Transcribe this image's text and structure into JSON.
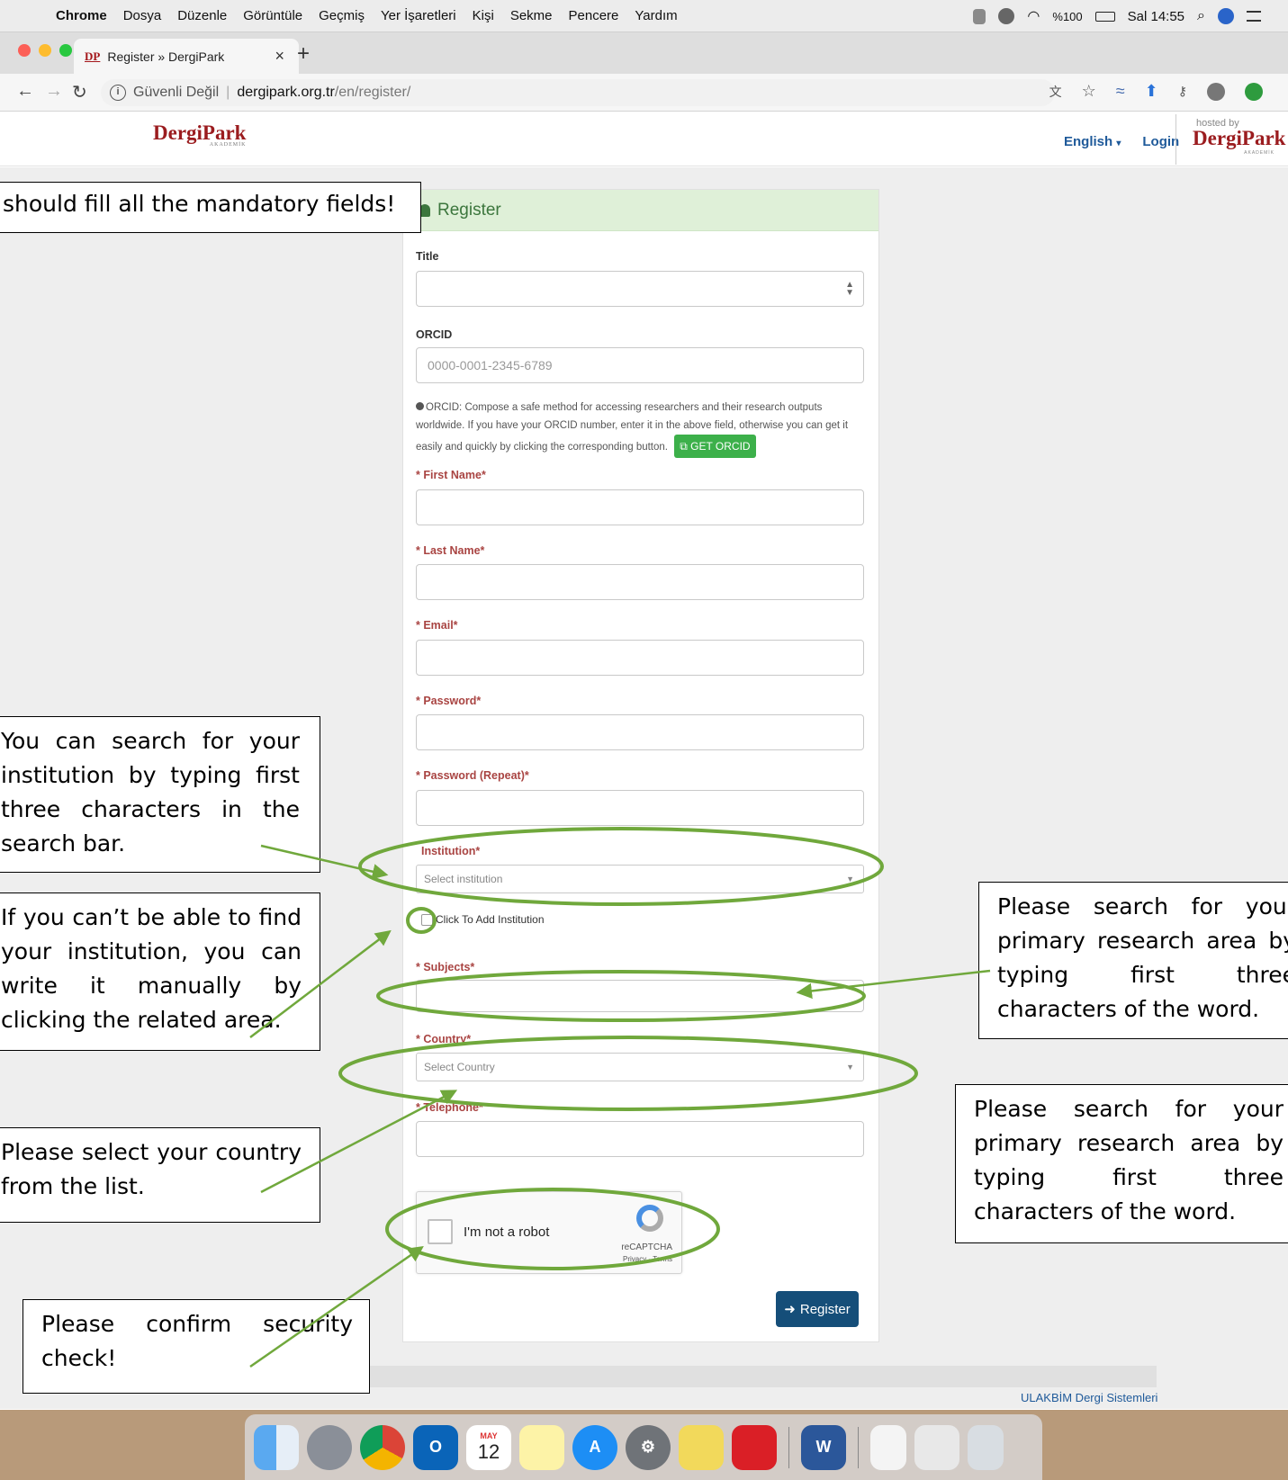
{
  "menubar": {
    "app": "Chrome",
    "items": [
      "Dosya",
      "Düzenle",
      "Görüntüle",
      "Geçmiş",
      "Yer İşaretleri",
      "Kişi",
      "Sekme",
      "Pencere",
      "Yardım"
    ],
    "battery": "%100",
    "clock": "Sal 14:55"
  },
  "browser": {
    "tab_title": "Register » DergiPark",
    "tab_favicon": "DP",
    "security_label": "Güvenli Değil",
    "url_host": "dergipark.org.tr",
    "url_path": "/en/register/"
  },
  "site": {
    "logo": "DergiPark",
    "logo_sub": "AKADEMİK",
    "language": "English",
    "login": "Login",
    "hosted_by": "hosted by",
    "hosted_logo": "DergiPark",
    "hosted_sub": "AKADEMİK",
    "footer_link": "ULAKBİM Dergi Sistemleri"
  },
  "form": {
    "heading": "Register",
    "title_label": "Title",
    "orcid_label": "ORCID",
    "orcid_placeholder": "0000-0001-2345-6789",
    "orcid_help": "ORCID: Compose a safe method for accessing researchers and their research outputs worldwide. If you have your ORCID number, enter it in the above field, otherwise you can get it easily and quickly by clicking the corresponding button.",
    "get_orcid": "GET ORCID",
    "first_name": "* First Name*",
    "last_name": "* Last Name*",
    "email": "* Email*",
    "password": "* Password*",
    "password_repeat": "* Password (Repeat)*",
    "institution": "Institution*",
    "institution_placeholder": "Select institution",
    "add_institution": "Click To Add Institution",
    "subjects": "* Subjects*",
    "country": "* Country*",
    "country_placeholder": "Select Country",
    "telephone": "* Telephone*",
    "captcha_text": "I'm not a robot",
    "captcha_brand": "reCAPTCHA",
    "captcha_links": "Privacy - Terms",
    "register_button": "Register"
  },
  "annotations": {
    "mandatory": "should fill all the mandatory fields!",
    "institution_search": "You can search for your institution by typing first three characters in the search bar.",
    "institution_manual": "If you can’t be able to find your institution, you can write it manually by clicking the related area.",
    "subjects_search": "Please search for your primary research area by typing first three characters of the word.",
    "country_select": "Please select your country from the list.",
    "research_area": "Please search for your primary research area by typing first three characters of the word.",
    "security": "Please confirm security check!"
  },
  "colors": {
    "annotation_green": "#70a83c",
    "brand_red": "#9b1c1f",
    "register_blue": "#154e79"
  },
  "dock": {
    "calendar_month": "MAY",
    "calendar_day": "12"
  }
}
